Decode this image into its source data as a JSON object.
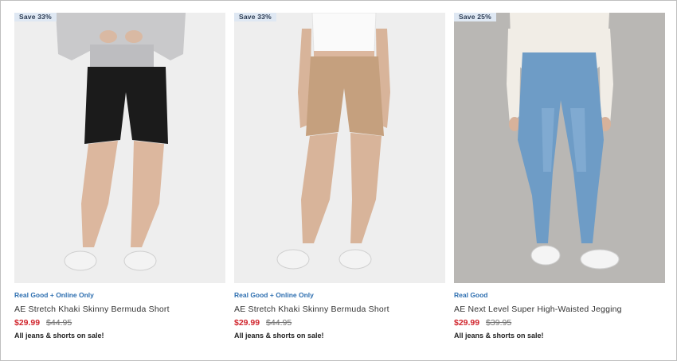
{
  "products": [
    {
      "badge": "Save 33%",
      "tag": "Real Good + Online Only",
      "name": "AE Stretch Khaki Skinny Bermuda Short",
      "sale_price": "$29.99",
      "original_price": "$44.95",
      "promo": "All jeans & shorts on sale!"
    },
    {
      "badge": "Save 33%",
      "tag": "Real Good + Online Only",
      "name": "AE Stretch Khaki Skinny Bermuda Short",
      "sale_price": "$29.99",
      "original_price": "$44.95",
      "promo": "All jeans & shorts on sale!"
    },
    {
      "badge": "Save 25%",
      "tag": "Real Good",
      "name": "AE Next Level Super High-Waisted Jegging",
      "sale_price": "$29.99",
      "original_price": "$39.95",
      "promo": "All jeans & shorts on sale!"
    }
  ],
  "colors": {
    "sale_price": "#d1262e",
    "tag": "#2e6fb0",
    "badge_bg": "#dfe8f3"
  }
}
